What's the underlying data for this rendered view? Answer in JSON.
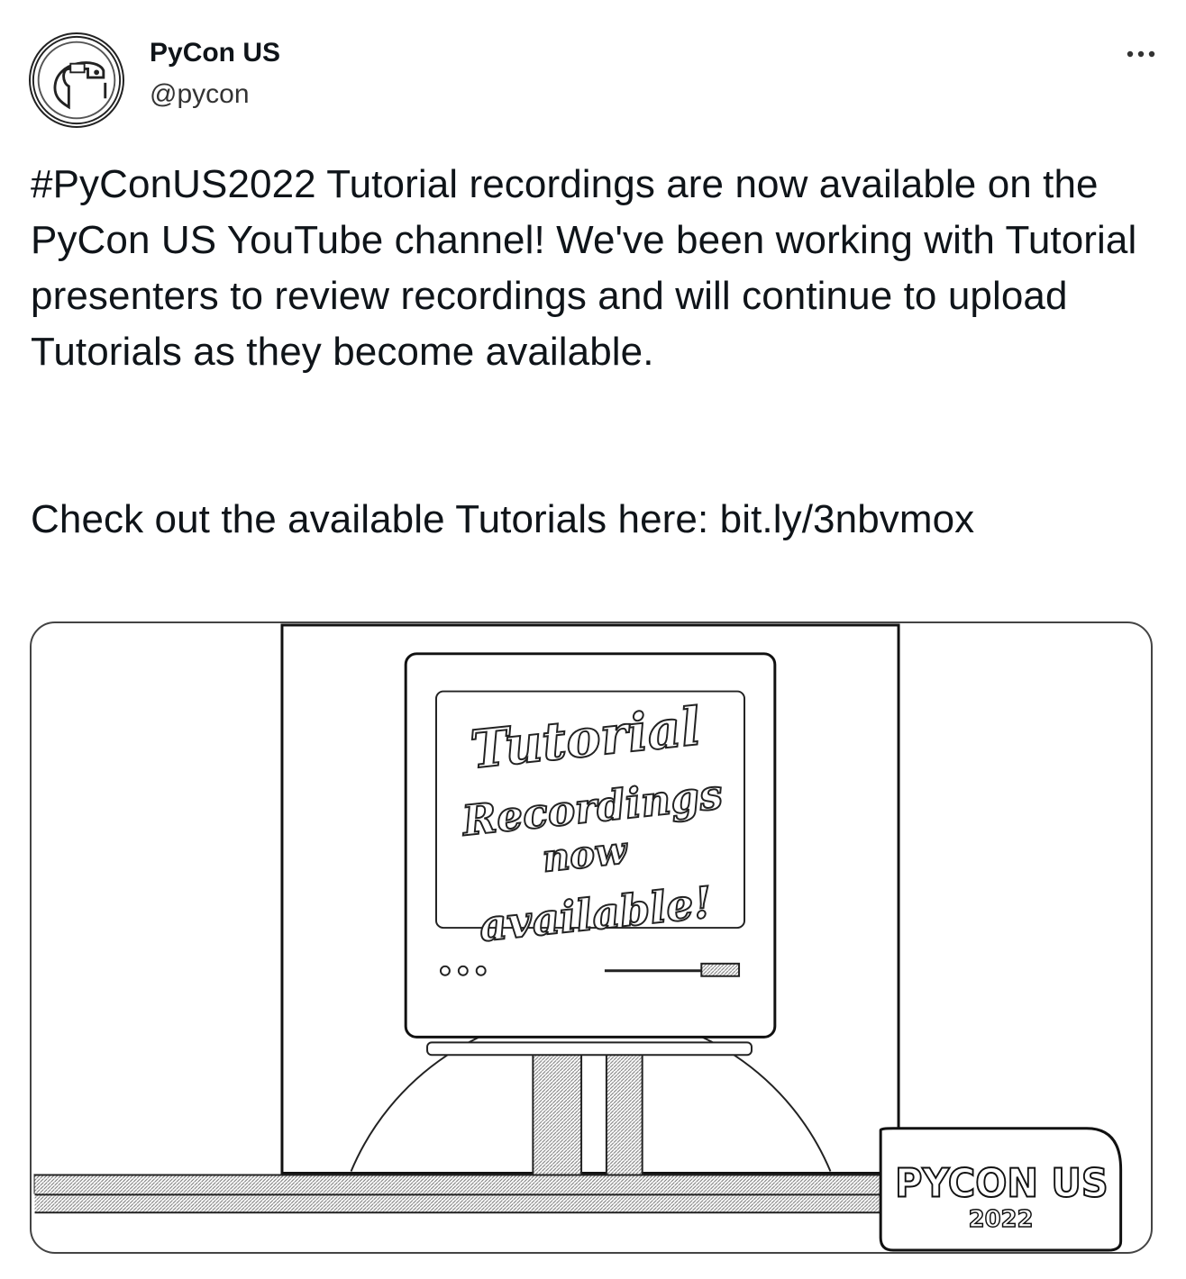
{
  "author": {
    "name": "PyCon US",
    "handle": "@pycon",
    "avatar_icon": "pycon-snake-logo"
  },
  "menu": {
    "icon": "more-horizontal-icon"
  },
  "tweet": {
    "body": "#PyConUS2022 Tutorial recordings are now available on the PyCon US YouTube channel! We've been working with Tutorial presenters to review recordings and will continue to upload Tutorials as they become available.",
    "cta_prefix": "Check out the available Tutorials here: ",
    "cta_link": "bit.ly/3nbvmox"
  },
  "media": {
    "screen_lines": [
      "Tutorial",
      "Recordings",
      "now",
      "available!"
    ],
    "logo_main": "PYCON US",
    "logo_year": "2022"
  }
}
